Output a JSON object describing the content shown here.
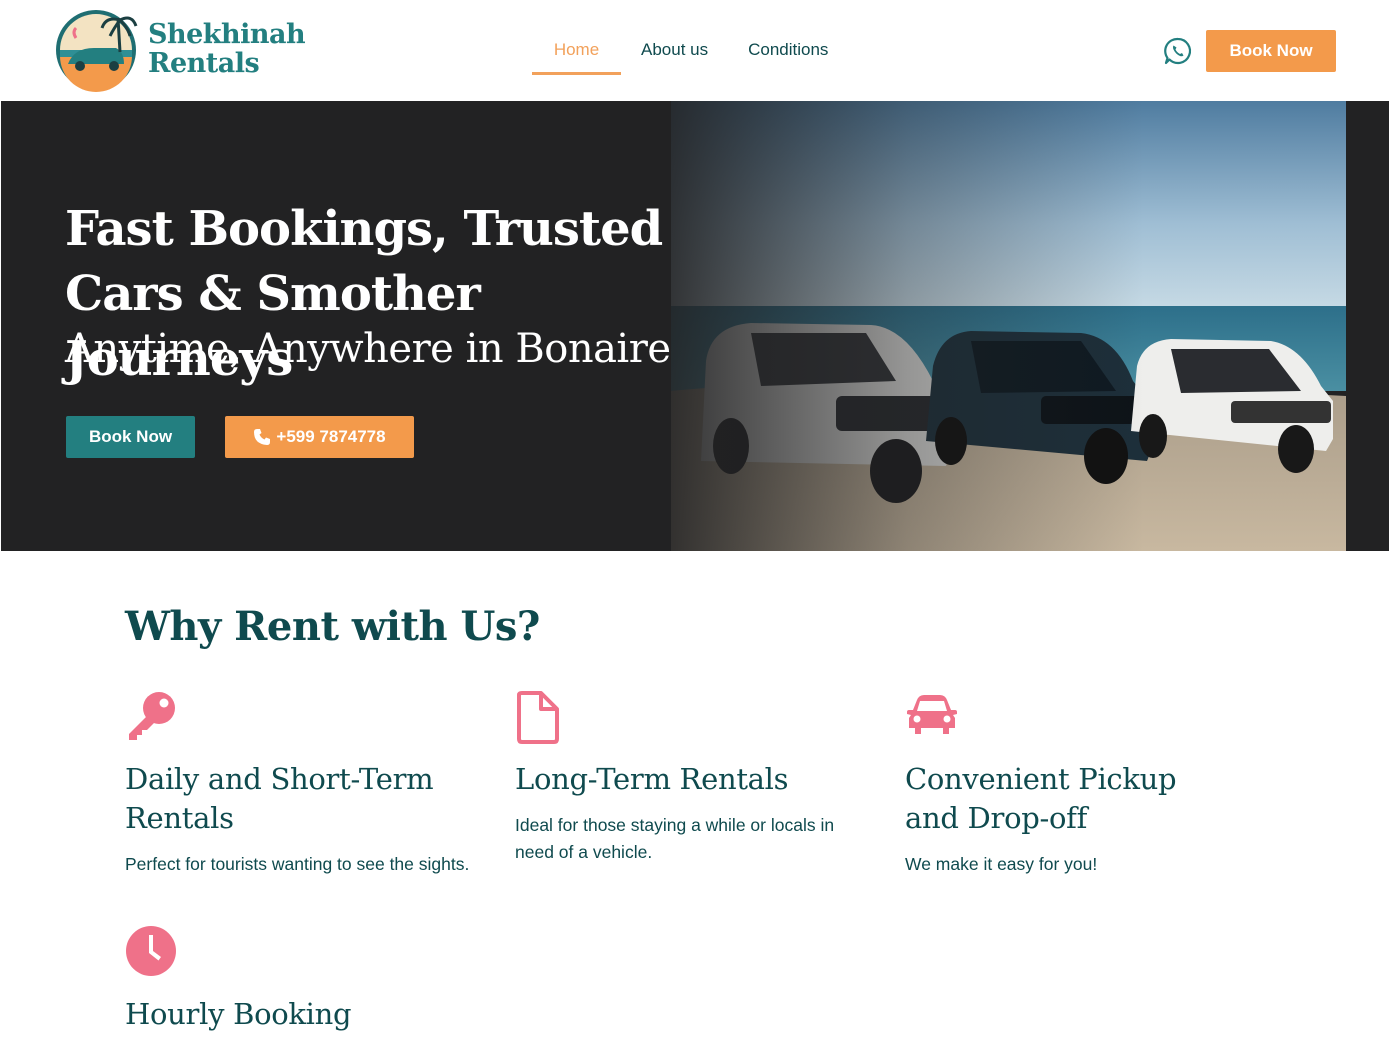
{
  "header": {
    "brand_line1": "Shekhinah",
    "brand_line2": "Rentals",
    "nav": [
      {
        "label": "Home",
        "active": true
      },
      {
        "label": "About us",
        "active": false
      },
      {
        "label": "Conditions",
        "active": false
      }
    ],
    "whatsapp_icon": "whatsapp-icon",
    "book_label": "Book Now"
  },
  "hero": {
    "title_line1": "Fast Bookings, Trusted",
    "title_line2": "Cars & Smother Journeys",
    "subtitle": "Anytime, Anywhere in Bonaire",
    "book_label": "Book Now",
    "phone_label": "+599 7874778",
    "phone_icon": "phone-icon"
  },
  "why": {
    "title": "Why Rent with Us?",
    "features": [
      {
        "icon": "key-icon",
        "title": "Daily and Short-Term Rentals",
        "desc": "Perfect for tourists wanting to see the sights."
      },
      {
        "icon": "document-icon",
        "title": "Long-Term Rentals",
        "desc": "Ideal for those staying a while or locals in need of a vehicle."
      },
      {
        "icon": "car-icon",
        "title": "Convenient Pickup and Drop-off",
        "desc": "We make it easy for you!"
      },
      {
        "icon": "clock-icon",
        "title": "Hourly Booking",
        "desc": ""
      }
    ]
  },
  "colors": {
    "teal": "#237f80",
    "dark_teal": "#0f4a4e",
    "orange": "#f39a4b",
    "pink": "#ef7189",
    "hero_bg": "#222223"
  }
}
